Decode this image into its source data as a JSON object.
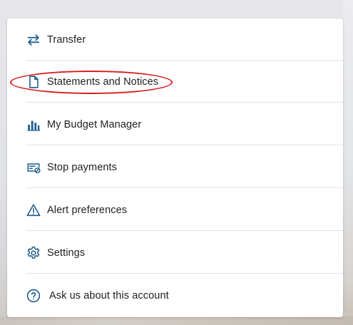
{
  "menu": {
    "items": [
      {
        "label": "Transfer",
        "icon": "transfer-arrows-icon"
      },
      {
        "label": "Statements and Notices",
        "icon": "document-icon"
      },
      {
        "label": "My Budget Manager",
        "icon": "bar-chart-icon"
      },
      {
        "label": "Stop payments",
        "icon": "check-stop-icon"
      },
      {
        "label": "Alert preferences",
        "icon": "warning-triangle-icon"
      },
      {
        "label": "Settings",
        "icon": "gear-icon"
      },
      {
        "label": "Ask us about this account",
        "icon": "help-question-icon"
      }
    ]
  },
  "colors": {
    "icon": "#1b5a8c",
    "text": "#1f1f1f",
    "divider": "#e3e3e3",
    "highlight": "#d41f1f",
    "card_background": "#ffffff"
  }
}
